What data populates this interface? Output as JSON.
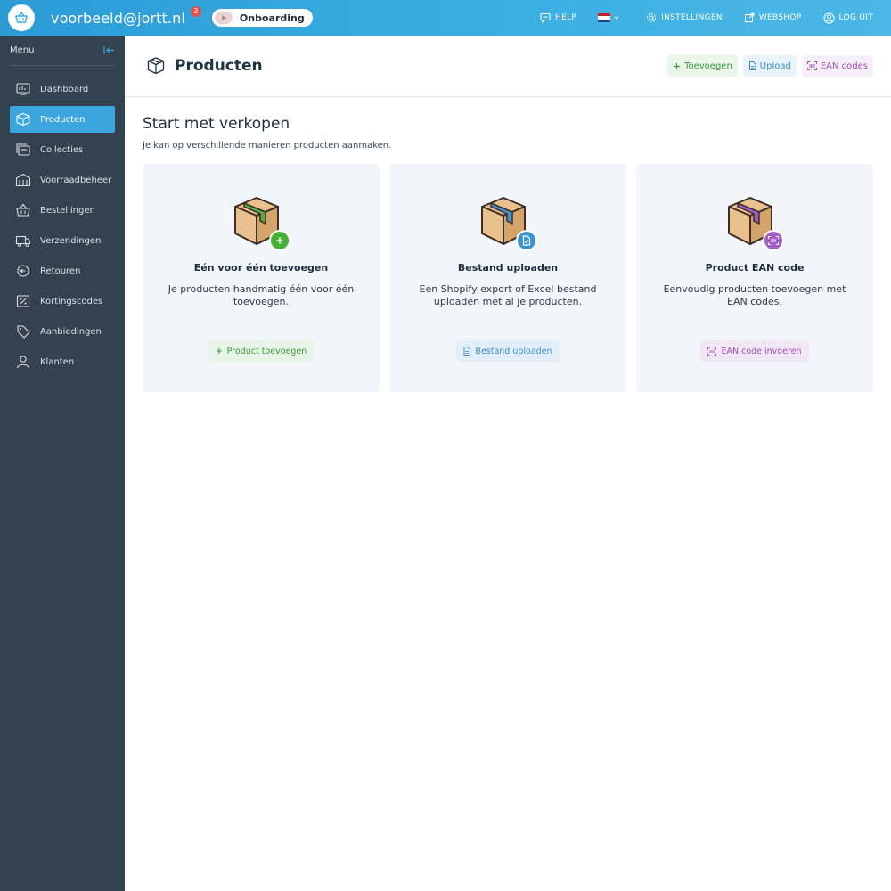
{
  "topbar": {
    "account": "voorbeeld@jortt.nl",
    "notification_count": "3",
    "onboarding_label": "Onboarding",
    "help_label": "HELP",
    "language_flag": "nl-flag-icon",
    "settings_label": "INSTELLINGEN",
    "webshop_label": "WEBSHOP",
    "logout_label": "LOG UIT"
  },
  "sidebar": {
    "title": "Menu",
    "items": [
      {
        "label": "Dashboard",
        "icon": "dashboard-icon"
      },
      {
        "label": "Producten",
        "icon": "box-icon",
        "active": true
      },
      {
        "label": "Collecties",
        "icon": "collections-icon"
      },
      {
        "label": "Voorraadbeheer",
        "icon": "warehouse-icon"
      },
      {
        "label": "Bestellingen",
        "icon": "basket-icon"
      },
      {
        "label": "Verzendingen",
        "icon": "truck-icon"
      },
      {
        "label": "Retouren",
        "icon": "return-icon"
      },
      {
        "label": "Kortingscodes",
        "icon": "discount-icon"
      },
      {
        "label": "Aanbiedingen",
        "icon": "tag-icon"
      },
      {
        "label": "Klanten",
        "icon": "user-icon"
      }
    ]
  },
  "header": {
    "title": "Producten",
    "add_label": "Toevoegen",
    "upload_label": "Upload",
    "ean_label": "EAN codes"
  },
  "main": {
    "title": "Start met verkopen",
    "subtitle": "Je kan op verschillende manieren producten aanmaken.",
    "cards": [
      {
        "title": "Eén voor één toevoegen",
        "description": "Je producten handmatig één voor één toevoegen.",
        "button": "Product toevoegen"
      },
      {
        "title": "Bestand uploaden",
        "description": "Een Shopify export of Excel bestand uploaden met al je producten.",
        "button": "Bestand uploaden"
      },
      {
        "title": "Product EAN code",
        "description": "Eenvoudig producten toevoegen met EAN codes.",
        "button": "EAN code invoeren"
      }
    ]
  },
  "colors": {
    "topbar": "#3aaee2",
    "sidebar": "#34424f",
    "active": "#3ba6dd",
    "green": "#3a9a3a",
    "blue": "#3a8cc4",
    "purple": "#a14fb3"
  }
}
